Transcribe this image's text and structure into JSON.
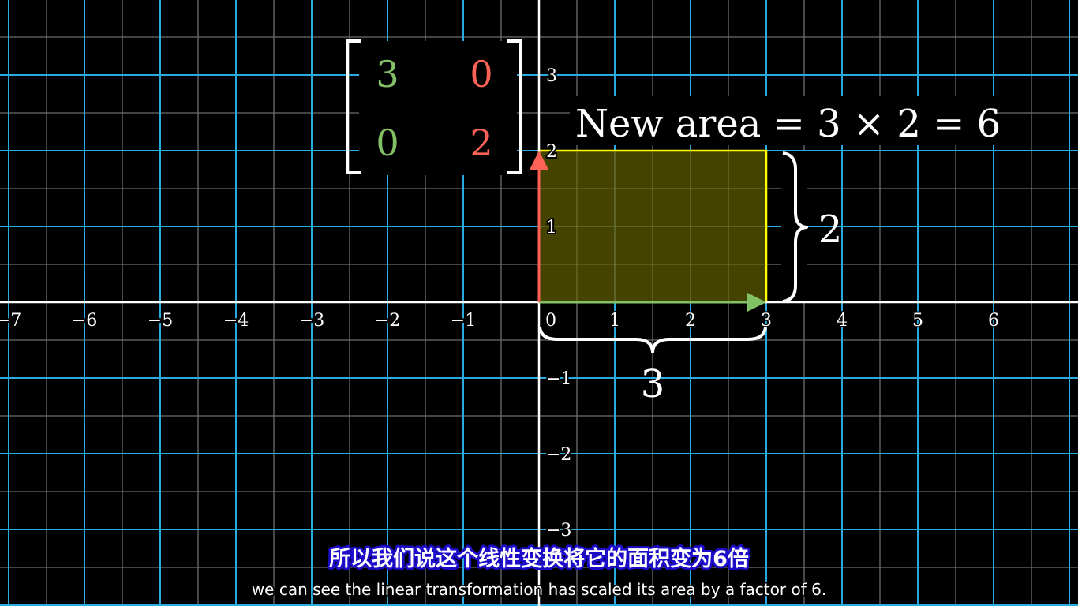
{
  "scene": {
    "x_tick_labels": [
      {
        "value": -7,
        "text": "−7"
      },
      {
        "value": -6,
        "text": "−6"
      },
      {
        "value": -5,
        "text": "−5"
      },
      {
        "value": -4,
        "text": "−4"
      },
      {
        "value": -3,
        "text": "−3"
      },
      {
        "value": -2,
        "text": "−2"
      },
      {
        "value": -1,
        "text": "−1"
      },
      {
        "value": 0,
        "text": "0"
      },
      {
        "value": 1,
        "text": "1"
      },
      {
        "value": 2,
        "text": "2"
      },
      {
        "value": 3,
        "text": "3"
      },
      {
        "value": 4,
        "text": "4"
      },
      {
        "value": 5,
        "text": "5"
      },
      {
        "value": 6,
        "text": "6"
      }
    ],
    "y_tick_labels": [
      {
        "value": 3,
        "text": "3"
      },
      {
        "value": 2,
        "text": "2"
      },
      {
        "value": 1,
        "text": "1"
      },
      {
        "value": -1,
        "text": "−1"
      },
      {
        "value": -2,
        "text": "−2"
      },
      {
        "value": -3,
        "text": "−3"
      }
    ],
    "matrix": {
      "a": "3",
      "b": "0",
      "c": "0",
      "d": "2"
    },
    "rect": {
      "width": 3,
      "height": 2
    },
    "brace_bottom_label": "3",
    "brace_right_label": "2",
    "area_equation": "New area = 3 × 2 = 6",
    "colors": {
      "background": "#000000",
      "major_grid": "#29abe2",
      "minor_grid": "#6e6e6e",
      "axis": "#ffffff",
      "i_hat": "#83c167",
      "j_hat": "#fc6255",
      "rect_fill": "#4d4a00",
      "rect_stroke": "#ffff00"
    }
  },
  "subtitles": {
    "zh": "所以我们说这个线性变换将它的面积变为6倍",
    "en": "we can see the linear transformation has scaled its area by a factor of 6."
  }
}
